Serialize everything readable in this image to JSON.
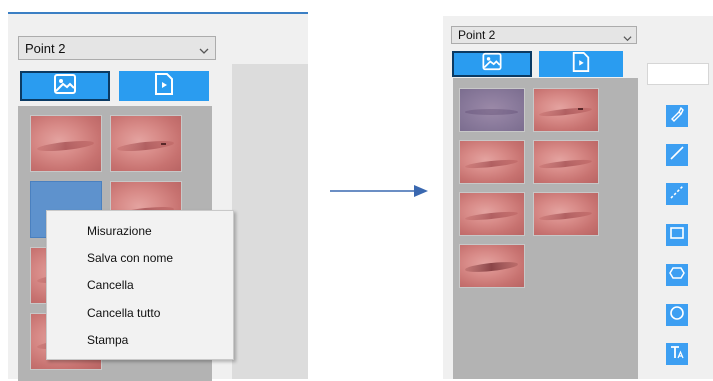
{
  "left_screen": {
    "point_select": {
      "value": "Point 2"
    },
    "context_menu": {
      "items": [
        "Misurazione",
        "Salva con nome",
        "Cancella",
        "Cancella tutto",
        "Stampa"
      ]
    }
  },
  "right_screen": {
    "point_select": {
      "value": "Point 2"
    },
    "tools": [
      "pen-icon",
      "line-icon",
      "dashed-line-icon",
      "rectangle-icon",
      "hexagon-icon",
      "circle-icon",
      "text-icon"
    ]
  },
  "colors": {
    "accent_blue": "#2a9cf0",
    "tool_blue": "#3d9ff2",
    "arrow_blue": "#3a68b0",
    "selected_thumb": "#5e92cd"
  }
}
